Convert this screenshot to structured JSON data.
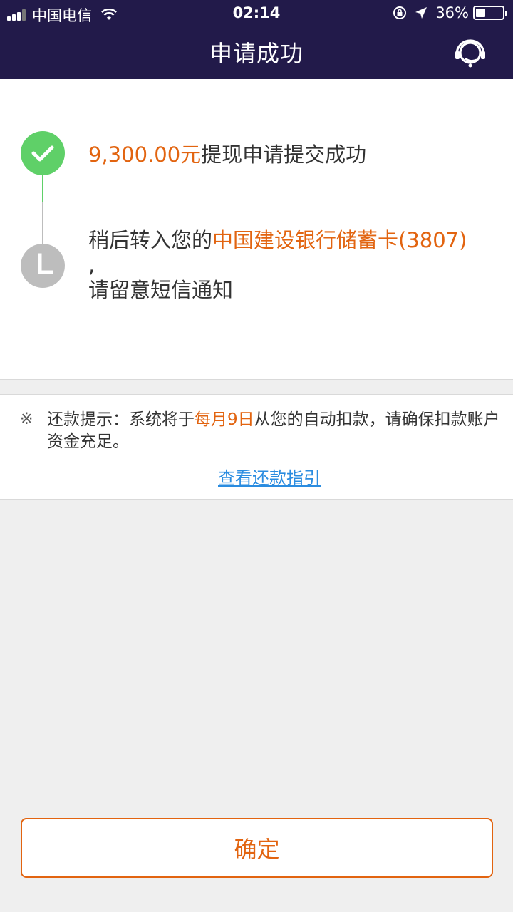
{
  "status_bar": {
    "carrier": "中国电信",
    "time": "02:14",
    "battery": "36%",
    "battery_level": 0.36
  },
  "header": {
    "title": "申请成功",
    "service_icon": "customer-service-icon"
  },
  "progress": {
    "step1": {
      "icon": "check-icon",
      "amount": "9,300.00元",
      "text": "提现申请提交成功"
    },
    "step2": {
      "icon": "clock-icon",
      "prefix": "稍后转入您的",
      "bank": "中国建设银行储蓄卡(3807)",
      "comma": ",",
      "suffix": "请留意短信通知"
    }
  },
  "notice": {
    "mark": "※",
    "prefix": "还款提示：系统将于",
    "date": "每月9日",
    "suffix": "从您的自动扣款，请确保扣款账户资金充足。",
    "link": "查看还款指引"
  },
  "confirm_label": "确定",
  "colors": {
    "header_bg": "#221a4a",
    "accent_orange": "#e26410",
    "success_green": "#5fd068",
    "link_blue": "#2a8ce0",
    "pending_gray": "#bdbdbd"
  }
}
